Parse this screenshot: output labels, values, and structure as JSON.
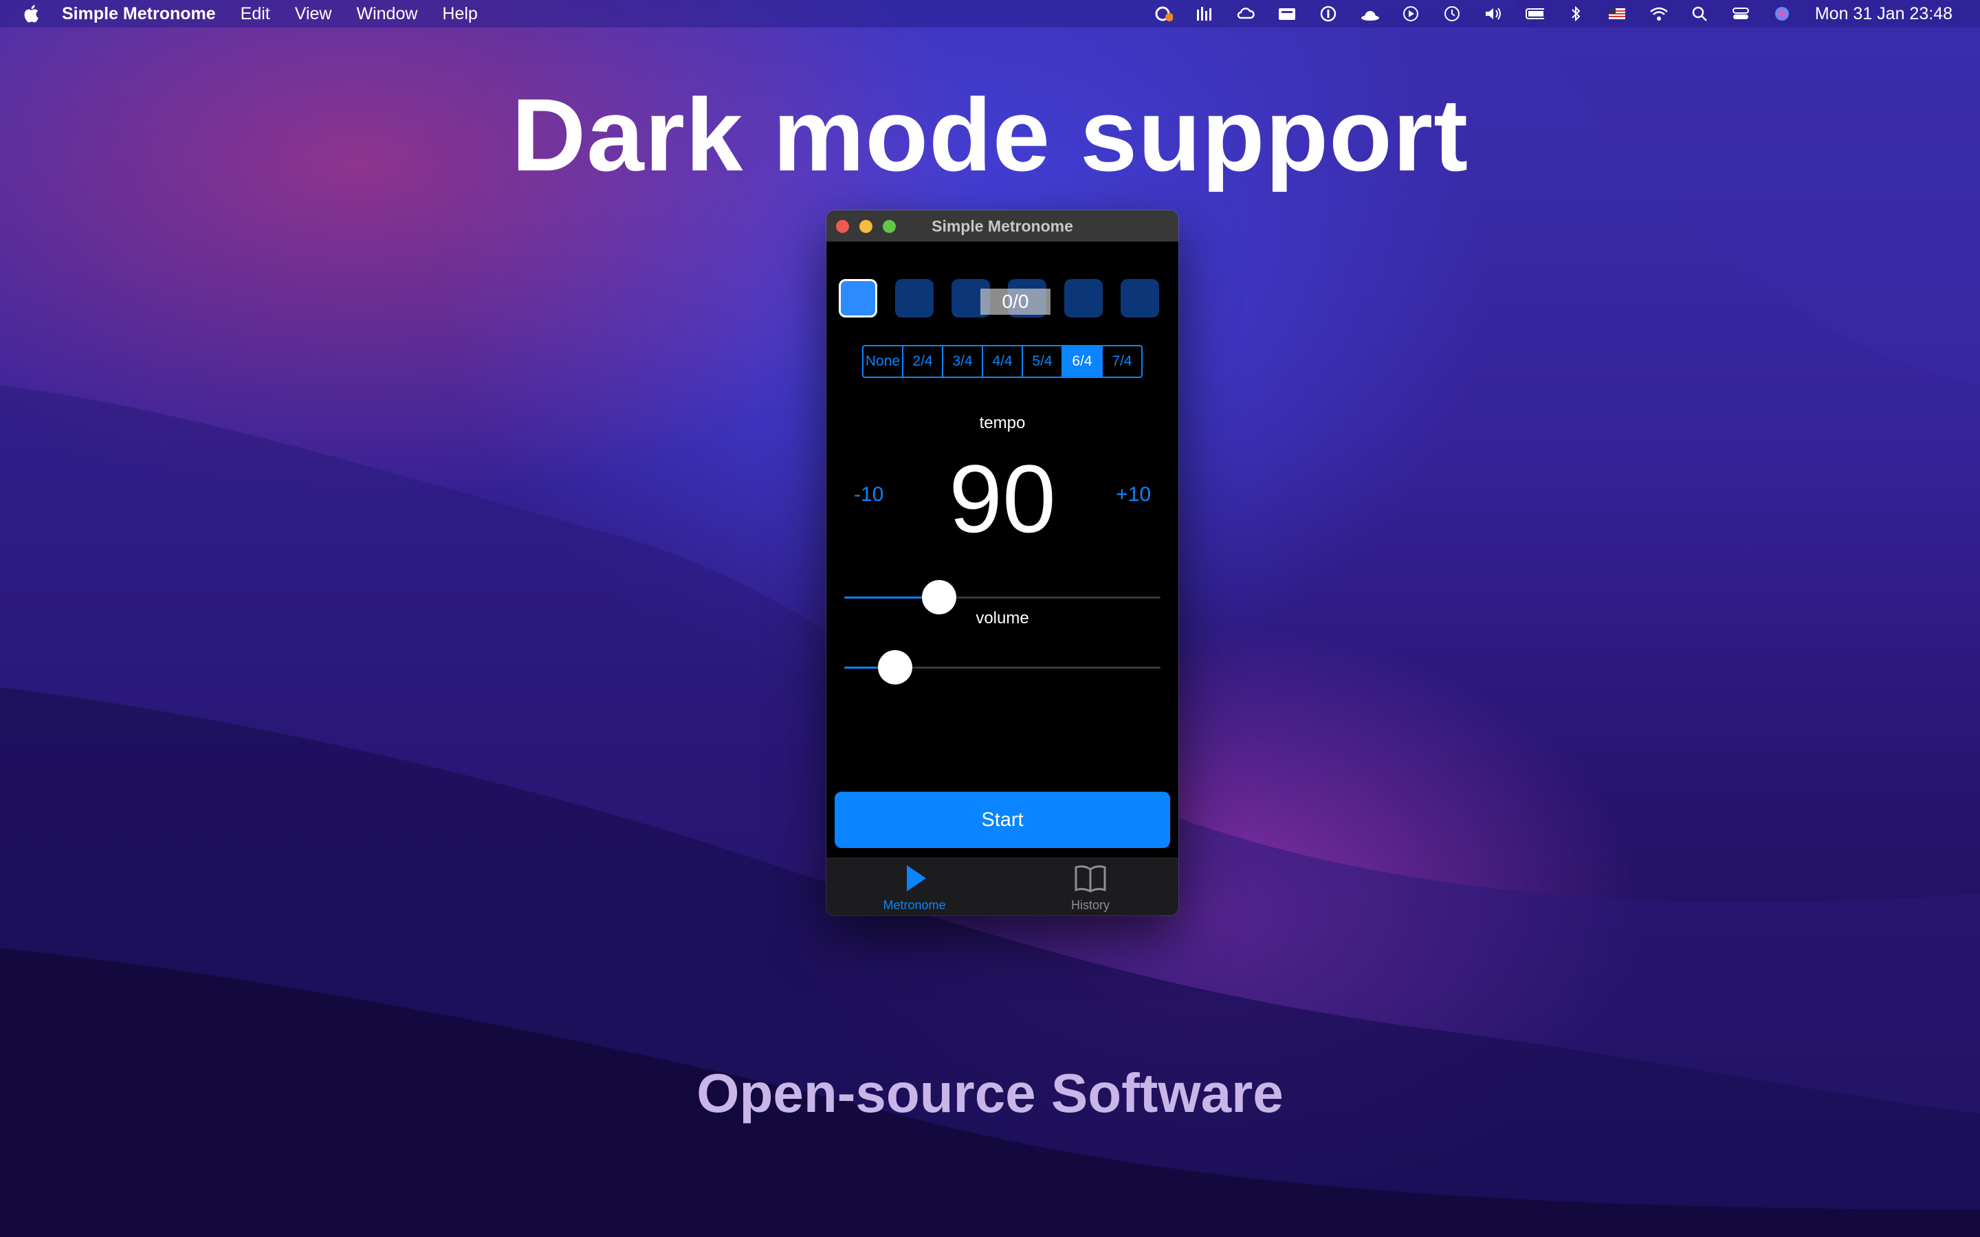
{
  "menubar": {
    "app_name": "Simple Metronome",
    "menus": [
      "Edit",
      "View",
      "Window",
      "Help"
    ],
    "clock": "Mon 31 Jan  23:48"
  },
  "headline": "Dark mode support",
  "footer": "Open-source Software",
  "window": {
    "title": "Simple Metronome",
    "beat_counter": "0/0",
    "time_signatures": [
      "None",
      "2/4",
      "3/4",
      "4/4",
      "5/4",
      "6/4",
      "7/4"
    ],
    "selected_time_signature": "6/4",
    "tempo_label": "tempo",
    "tempo_value": "90",
    "minus_label": "-10",
    "plus_label": "+10",
    "tempo_slider_level": 0.3,
    "volume_label": "volume",
    "volume_slider_level": 0.16,
    "start_label": "Start",
    "tabs": {
      "metronome": "Metronome",
      "history": "History"
    }
  },
  "colors": {
    "accent": "#0a84ff",
    "beat_inactive": "#0b3778",
    "beat_active": "#2c8cff"
  }
}
